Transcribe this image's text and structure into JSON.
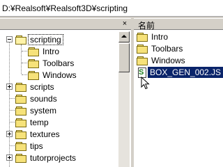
{
  "address": {
    "path": "D:¥Realsoft¥Realsoft3D¥scripting"
  },
  "tree_pane": {
    "close_symbol": "×",
    "items": [
      {
        "label": "scripting",
        "state": "expanded",
        "level": 0
      },
      {
        "label": "Intro",
        "state": "leaf",
        "level": 1
      },
      {
        "label": "Toolbars",
        "state": "leaf",
        "level": 1
      },
      {
        "label": "Windows",
        "state": "leaf",
        "level": 1
      },
      {
        "label": "scripts",
        "state": "collapsed",
        "level": 0
      },
      {
        "label": "sounds",
        "state": "leaf",
        "level": 0
      },
      {
        "label": "system",
        "state": "leaf",
        "level": 0
      },
      {
        "label": "temp",
        "state": "leaf",
        "level": 0
      },
      {
        "label": "textures",
        "state": "collapsed",
        "level": 0
      },
      {
        "label": "tips",
        "state": "leaf",
        "level": 0
      },
      {
        "label": "tutorprojects",
        "state": "collapsed",
        "level": 0
      }
    ]
  },
  "list_pane": {
    "column_header": "名前",
    "items": [
      {
        "label": "Intro",
        "type": "folder"
      },
      {
        "label": "Toolbars",
        "type": "folder"
      },
      {
        "label": "Windows",
        "type": "folder"
      },
      {
        "label": "BOX_GEN_002.JS",
        "type": "script-file",
        "selected": true
      }
    ]
  }
}
